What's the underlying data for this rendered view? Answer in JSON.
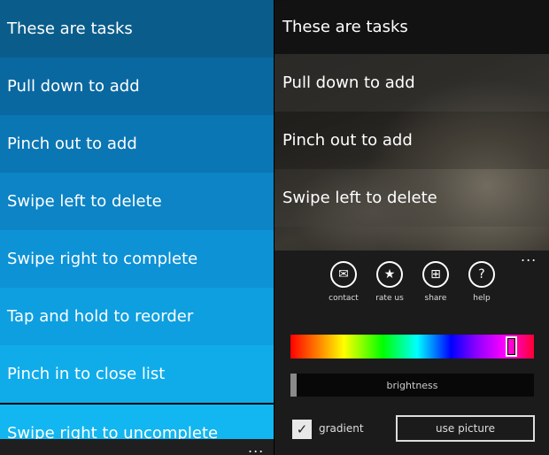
{
  "left_panel": {
    "tasks": [
      {
        "label": "These are tasks",
        "color": "#0a5d8a"
      },
      {
        "label": "Pull down to add",
        "color": "#0a68a0"
      },
      {
        "label": "Pinch out to add",
        "color": "#0b76b4"
      },
      {
        "label": "Swipe left to delete",
        "color": "#0c84c6"
      },
      {
        "label": "Swipe right to complete",
        "color": "#0d92d6"
      },
      {
        "label": "Tap and hold to reorder",
        "color": "#0e9fe0"
      },
      {
        "label": "Pinch in to close list",
        "color": "#10acea"
      },
      {
        "label": "Swipe right to uncomplete",
        "color": "#12b6f0"
      }
    ],
    "more_glyph": "..."
  },
  "right_panel": {
    "tasks": [
      {
        "label": "These are tasks"
      },
      {
        "label": "Pull down to add"
      },
      {
        "label": "Pinch out to add"
      },
      {
        "label": "Swipe left to delete"
      }
    ],
    "more_glyph": "...",
    "actions": [
      {
        "label": "contact",
        "icon": "mail-icon",
        "glyph": "✉"
      },
      {
        "label": "rate us",
        "icon": "star-icon",
        "glyph": "★"
      },
      {
        "label": "share",
        "icon": "gift-icon",
        "glyph": "⊞"
      },
      {
        "label": "help",
        "icon": "help-icon",
        "glyph": "?"
      }
    ],
    "brightness_label": "brightness",
    "brightness_level": 0,
    "gradient_label": "gradient",
    "gradient_checked": true,
    "use_picture_label": "use picture"
  }
}
